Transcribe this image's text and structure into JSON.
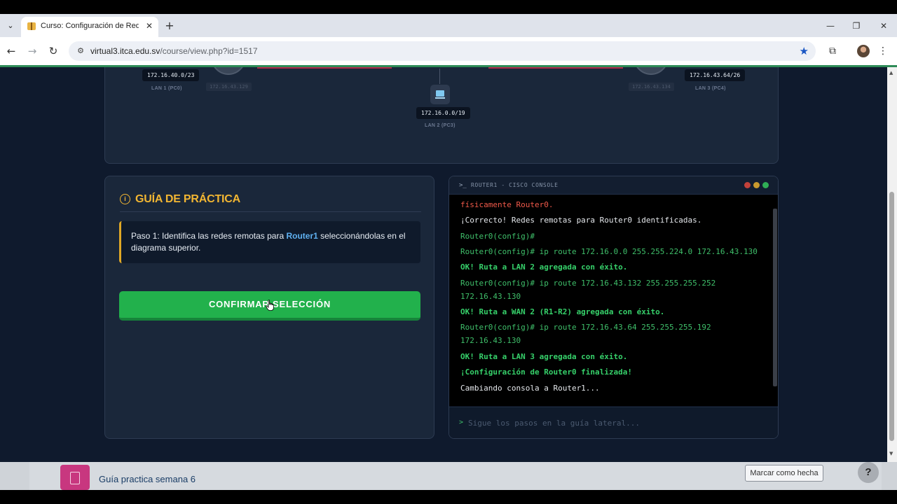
{
  "browser": {
    "tab_title": "Curso: Configuración de Redes",
    "url_host": "virtual3.itca.edu.sv",
    "url_path": "/course/view.php?id=1517",
    "icons": [
      "tab-list-icon",
      "close-icon",
      "new-tab-icon",
      "minimize-icon",
      "restore-icon",
      "close-window-icon",
      "back-icon",
      "forward-icon",
      "reload-icon",
      "site-info-icon",
      "bookmark-star-icon",
      "extensions-icon",
      "profile-avatar",
      "menu-icon"
    ]
  },
  "diagram": {
    "lan1": {
      "network": "172.16.40.0/23",
      "label": "LAN 1 (PC0)"
    },
    "lan2": {
      "network": "172.16.0.0/19",
      "label": "LAN 2 (PC3)"
    },
    "lan3": {
      "network": "172.16.43.64/26",
      "label": "LAN 3 (PC4)"
    },
    "faint_ip_left": "172.16.43.129",
    "faint_ip_right": "172.16.43.134"
  },
  "guide": {
    "title": "GUÍA DE PRÁCTICA",
    "step_prefix": "Paso 1: Identifica las redes remotas para ",
    "step_router": "Router1",
    "step_suffix": " seleccionándolas en el diagrama superior.",
    "confirm_label": "CONFIRMAR SELECCIÓN"
  },
  "console": {
    "title": "ROUTER1 - CISCO CONSOLE",
    "prompt_symbol": ">_",
    "lines": [
      {
        "text": "físicamente Router0.",
        "style": "red"
      },
      {
        "text": "¡Correcto! Redes remotas para Router0 identificadas.",
        "style": "white"
      },
      {
        "text": "Router0(config)#",
        "style": "green"
      },
      {
        "text": "Router0(config)# ip route 172.16.0.0 255.255.224.0 172.16.43.130",
        "style": "green"
      },
      {
        "text": "OK! Ruta a LAN 2 agregada con éxito.",
        "style": "greenb"
      },
      {
        "text": "Router0(config)# ip route 172.16.43.132 255.255.255.252",
        "style": "green"
      },
      {
        "text": "172.16.43.130",
        "style": "green"
      },
      {
        "text": "OK! Ruta a WAN 2 (R1-R2) agregada con éxito.",
        "style": "greenb"
      },
      {
        "text": "Router0(config)# ip route 172.16.43.64 255.255.255.192",
        "style": "green"
      },
      {
        "text": "172.16.43.130",
        "style": "green"
      },
      {
        "text": "OK! Ruta a LAN 3 agregada con éxito.",
        "style": "greenb"
      },
      {
        "text": "¡Configuración de Router0 finalizada!",
        "style": "greenb"
      },
      {
        "text": "Cambiando consola a Router1...",
        "style": "white"
      }
    ],
    "input_chevron": ">",
    "input_placeholder": "Sigue los pasos en la guía lateral..."
  },
  "course_bar": {
    "activity_title": "Guía practica semana 6",
    "mark_done_label": "Marcar como hecha",
    "help_label": "?"
  },
  "colors": {
    "accent_yellow": "#f2b632",
    "confirm_green": "#22b14c",
    "console_green": "#3fbf6a",
    "console_red": "#f0594a",
    "link_blue": "#5fb0f0"
  }
}
